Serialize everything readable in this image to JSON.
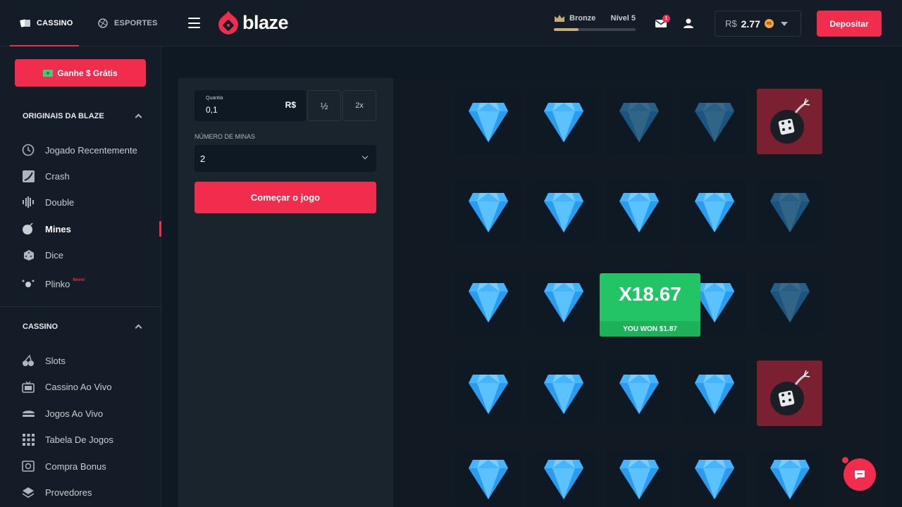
{
  "header": {
    "tabs": [
      {
        "label": "CASSINO",
        "icon": "cards-icon",
        "active": true
      },
      {
        "label": "ESPORTES",
        "icon": "ball-icon",
        "active": false
      }
    ],
    "logo_text": "blaze",
    "rank": {
      "tier": "Bronze",
      "level": "Nível 5",
      "progress": 0.3
    },
    "mail_badge": "1",
    "balance": {
      "currency": "R$",
      "amount": "2.77",
      "coin_label": "R$"
    },
    "deposit_label": "Depositar"
  },
  "sidebar": {
    "free_button": "Ganhe $ Grátis",
    "sections": [
      {
        "title": "ORIGINAIS DA BLAZE",
        "items": [
          {
            "label": "Jogado Recentemente",
            "icon": "clock-icon"
          },
          {
            "label": "Crash",
            "icon": "crash-chart-icon"
          },
          {
            "label": "Double",
            "icon": "double-wheel-icon"
          },
          {
            "label": "Mines",
            "icon": "mine-icon",
            "active": true
          },
          {
            "label": "Dice",
            "icon": "dice-icon"
          },
          {
            "label": "Plinko",
            "icon": "plinko-icon",
            "badge": "Novo!"
          }
        ]
      },
      {
        "title": "CASSINO",
        "items": [
          {
            "label": "Slots",
            "icon": "cherries-icon"
          },
          {
            "label": "Cassino Ao Vivo",
            "icon": "tv-icon"
          },
          {
            "label": "Jogos Ao Vivo",
            "icon": "live-games-icon"
          },
          {
            "label": "Tabela De Jogos",
            "icon": "grid-icon"
          },
          {
            "label": "Compra Bonus",
            "icon": "money-icon"
          },
          {
            "label": "Provedores",
            "icon": "providers-icon"
          }
        ]
      }
    ]
  },
  "bet_panel": {
    "amount_label": "Quantia",
    "amount_value": "0,1",
    "amount_currency": "R$",
    "half_label": "½",
    "double_label": "2x",
    "mines_label": "NÚMERO DE MINAS",
    "mines_value": "2",
    "start_label": "Começar o jogo"
  },
  "board": {
    "tiles": [
      [
        "gem",
        "gem",
        "gem-dim",
        "gem-dim",
        "bomb"
      ],
      [
        "gem",
        "gem",
        "gem",
        "gem",
        "gem-dim"
      ],
      [
        "gem",
        "gem",
        "gem",
        "gem",
        "gem-dim"
      ],
      [
        "gem",
        "gem",
        "gem",
        "gem",
        "bomb"
      ],
      [
        "gem",
        "gem",
        "gem",
        "gem",
        "gem"
      ]
    ],
    "win": {
      "multiplier": "X18.67",
      "message": "YOU WON $1.87"
    }
  },
  "colors": {
    "accent": "#f12c4c",
    "win": "#23c465",
    "gem": "#2a9cf0"
  }
}
